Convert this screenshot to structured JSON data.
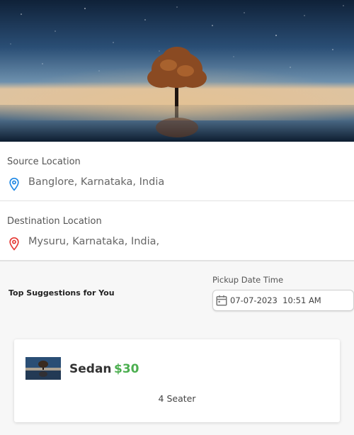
{
  "hero": {
    "image": "night-sky-tree-lake"
  },
  "source": {
    "label": "Source Location",
    "value": "Banglore, Karnataka, India",
    "icon": "location-pin-icon",
    "icon_color": "#1e88e5"
  },
  "destination": {
    "label": "Destination Location",
    "value": "Mysuru, Karnataka, India,",
    "icon": "location-pin-icon",
    "icon_color": "#e53935"
  },
  "suggestions": {
    "title": "Top Suggestions for You"
  },
  "pickup": {
    "label": "Pickup Date Time",
    "value": "07-07-2023  10:51 AM",
    "icon": "calendar-icon"
  },
  "cars": [
    {
      "name": "Sedan",
      "price": "$30",
      "seats": "4 Seater"
    }
  ],
  "colors": {
    "price": "#4caf50",
    "source_pin": "#1e88e5",
    "destination_pin": "#e53935"
  }
}
